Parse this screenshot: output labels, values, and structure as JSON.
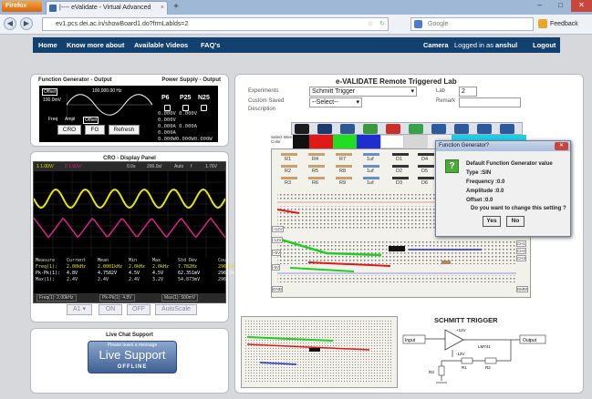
{
  "browser": {
    "menu_button": "Firefox",
    "tab_title": "|---- eValidate - Virtual Advanced",
    "url": "ev1.pcs.dei.ac.in/showBoard1.do?frmLablds=2",
    "search_placeholder": "Google",
    "feedback_label": "Feedback",
    "window_buttons": [
      "–",
      "□",
      "✕"
    ]
  },
  "sitenav": {
    "home": "Home",
    "know_more": "Know more about",
    "videos": "Available Videos",
    "faq": "FAQ's",
    "camera": "Camera",
    "logged_in_prefix": "Logged in as",
    "username": "anshul",
    "logout": "Logout"
  },
  "function_generator": {
    "title": "Function Generator - Output",
    "power_title": "Power Supply - Output",
    "offset_label": "Offset",
    "amplitude_label": "100.0mV",
    "period_label": "100,000.00 Hz",
    "freq_label": "Freq",
    "ampl_label": "Ampl",
    "offset_btn": "Offset",
    "buttons": [
      "CRO",
      "FG",
      "Refresh"
    ],
    "ps_channels": [
      "P6",
      "P25",
      "N25"
    ],
    "ps_rows": [
      "0.000V 0.000V 0.000V",
      "0.000A 0.000A 0.000A",
      "0.000W0.000W0.000W"
    ]
  },
  "cro": {
    "title": "CRO - Display Panel",
    "header": [
      "1 1.00V/",
      "2 1.00V/",
      "0.0s",
      "200.0s/",
      "Auto",
      "f",
      "1.76V"
    ],
    "measure_cols": [
      "Measure",
      "Current",
      "Mean",
      "Min",
      "Max",
      "Std Dev",
      "Count"
    ],
    "measure_rows": [
      [
        "Freq(1):",
        "2.00kHz",
        "2.0001kHz",
        "2.0kHz",
        "2.0kHz",
        "7.782Hz",
        "296.2k"
      ],
      [
        "Pk-Pk(1):",
        "4.8V",
        "4.7582V",
        "4.5V",
        "4.5V",
        "62.351mV",
        "296.2k"
      ],
      [
        "Max(1):",
        "2.4V",
        "2.4V",
        "2.4V",
        "3.2V",
        "54.873mV",
        "296.2k"
      ]
    ],
    "footer": [
      "Freq(1): 2.00kHz",
      "Pk-Pk(1): 4.8V",
      "Max(1): 500mV"
    ],
    "buttons": [
      "ON",
      "OFF",
      "AutoScale"
    ],
    "channel_select": "A1"
  },
  "chat": {
    "title": "Live Chat Support",
    "tagline": "Please leave a message",
    "live_support": "Live Support",
    "status": "OFFLINE"
  },
  "lab": {
    "title": "e-VALIDATE Remote Triggered Lab",
    "experiments_label": "Experiments",
    "experiment_value": "Schmitt Trigger",
    "lab_label": "Lab",
    "lab_value": "2",
    "custom_saved_label": "Custom Saved",
    "custom_saved_value": "--Select--",
    "remark_label": "Remark",
    "description_label": "Description",
    "select_wire_label": "Select Wire Color",
    "components": [
      "R1",
      "R4",
      "R7",
      "1uf",
      "D1",
      "D4",
      "R2",
      "R5",
      "R8",
      "1uf",
      "D2",
      "D5",
      "R3",
      "R6",
      "R9",
      "1uf",
      "D3",
      "D6"
    ],
    "rails": [
      "CH1",
      "CH2",
      "CH3",
      "+12V",
      "-12V",
      "+5V",
      "-5V",
      "GND",
      "DMM"
    ],
    "schematic_title": "SCHMITT TRIGGER",
    "schematic_labels": [
      "Input",
      "Output",
      "+12V",
      "-12V",
      "R1",
      "R2",
      "R3",
      "LM741"
    ]
  },
  "dialog": {
    "title": "Function Generator?",
    "heading": "Default Function Generator value",
    "type": "Type :SIN",
    "frequency": "Frequency :0.0",
    "amplitude": "Amplitude :0.0",
    "offset": "Offset :0.0",
    "question": "Do you want to change this setting ?",
    "yes": "Yes",
    "no": "No"
  },
  "colors": {
    "nav_bg": "#12406f",
    "trace_ch1": "#e6e600",
    "trace_ch2": "#e0208a",
    "accent_green": "#4caa3a"
  }
}
